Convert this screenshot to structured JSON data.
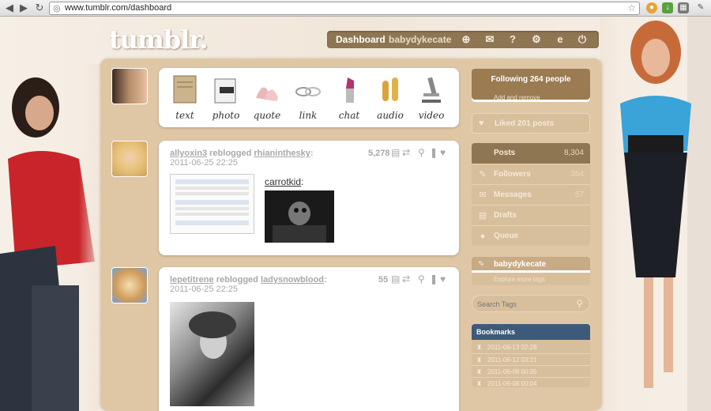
{
  "browser": {
    "url": "www.tumblr.com/dashboard",
    "back_icon": "arrow-left-icon",
    "forward_icon": "arrow-right-icon",
    "reload_icon": "reload-icon"
  },
  "site": {
    "logo": "tumblr."
  },
  "topnav": {
    "dashboard": "Dashboard",
    "username": "babydykecate",
    "icons": [
      "plus-circle-icon",
      "envelope-icon",
      "help-icon",
      "gear-icon",
      "e-icon",
      "power-icon"
    ]
  },
  "post_types": [
    {
      "label": "text",
      "icon": "notebook-icon"
    },
    {
      "label": "photo",
      "icon": "camera-icon"
    },
    {
      "label": "quote",
      "icon": "shoes-icon"
    },
    {
      "label": "link",
      "icon": "chain-icon"
    },
    {
      "label": "chat",
      "icon": "lipstick-icon"
    },
    {
      "label": "audio",
      "icon": "shells-icon"
    },
    {
      "label": "video",
      "icon": "microscope-icon"
    }
  ],
  "posts": [
    {
      "author": "allyoxin3",
      "action": "reblogged",
      "source": "rhianinthesky",
      "date": "2011-06-25 22:25",
      "notes": "5,278",
      "caption_link": "carrotkid"
    },
    {
      "author": "lepetitrene",
      "action": "reblogged",
      "source": "ladysnowblood",
      "date": "2011-06-25 22:25",
      "notes": "55"
    }
  ],
  "sidebar": {
    "following": "Following 264 people",
    "following_sub": "Add and remove",
    "liked": "Liked 201 posts",
    "nav": [
      {
        "label": "Posts",
        "count": "8,304",
        "icon": "posts-icon"
      },
      {
        "label": "Followers",
        "count": "364",
        "icon": "followers-icon"
      },
      {
        "label": "Messages",
        "count": "57",
        "icon": "messages-icon"
      },
      {
        "label": "Drafts",
        "count": "",
        "icon": "drafts-icon"
      },
      {
        "label": "Queue",
        "count": "",
        "icon": "queue-icon"
      }
    ],
    "tag_user": "babydykecate",
    "explore": "Explore more tags",
    "search_placeholder": "Search Tags",
    "bookmarks_title": "Bookmarks",
    "bookmarks": [
      "2011-06-13 02:28",
      "2011-06-12 03:21",
      "2011-06-08 00:35",
      "2011-06-08 00:04"
    ]
  },
  "colors": {
    "panel": "#dfc7a6",
    "nav_bar": "#8f7652",
    "bookmarks_header": "#3d5a7a"
  }
}
